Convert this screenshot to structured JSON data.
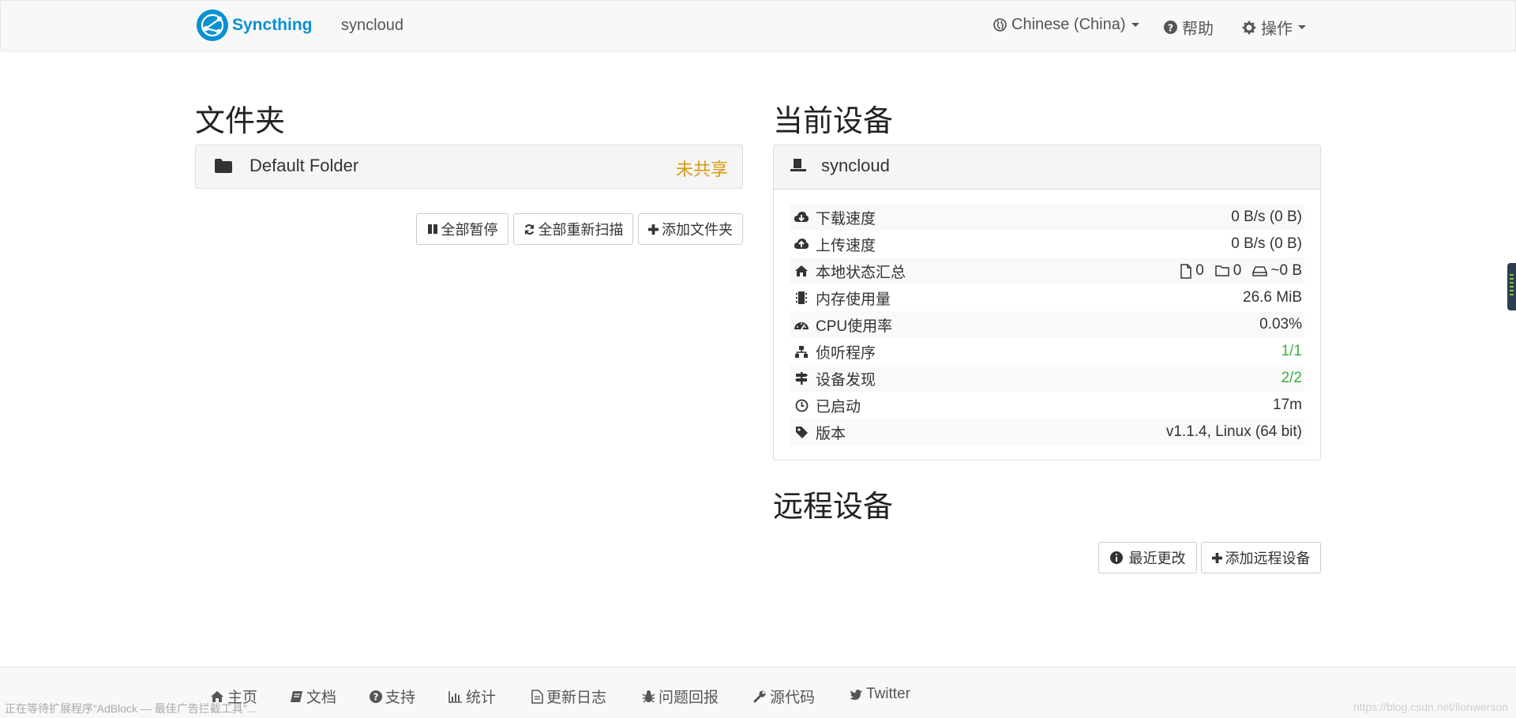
{
  "navbar": {
    "brand": "Syncthing",
    "device_name": "syncloud",
    "language": "Chinese (China)",
    "help": "帮助",
    "actions": "操作"
  },
  "folders": {
    "heading": "文件夹",
    "items": [
      {
        "name": "Default Folder",
        "status": "未共享"
      }
    ],
    "buttons": {
      "pause_all": "全部暂停",
      "rescan_all": "全部重新扫描",
      "add_folder": "添加文件夹"
    }
  },
  "this_device": {
    "heading": "当前设备",
    "name": "syncloud",
    "stats": [
      {
        "icon": "cloud-download-icon",
        "label": "下载速度",
        "value": "0 B/s (0 B)"
      },
      {
        "icon": "cloud-upload-icon",
        "label": "上传速度",
        "value": "0 B/s (0 B)"
      },
      {
        "icon": "home-icon",
        "label": "本地状态汇总",
        "value": ""
      },
      {
        "icon": "memory-icon",
        "label": "内存使用量",
        "value": "26.6 MiB"
      },
      {
        "icon": "dashboard-icon",
        "label": "CPU使用率",
        "value": "0.03%"
      },
      {
        "icon": "sitemap-icon",
        "label": "侦听程序",
        "value": "1/1"
      },
      {
        "icon": "signpost-icon",
        "label": "设备发现",
        "value": "2/2"
      },
      {
        "icon": "clock-icon",
        "label": "已启动",
        "value": "17m"
      },
      {
        "icon": "tag-icon",
        "label": "版本",
        "value": "v1.1.4, Linux (64 bit)"
      }
    ],
    "local_state": {
      "files": "0",
      "dirs": "0",
      "size": "~0 B"
    }
  },
  "remote_devices": {
    "heading": "远程设备",
    "buttons": {
      "recent_changes": "最近更改",
      "add_remote": "添加远程设备"
    }
  },
  "footer": {
    "links": [
      "主页",
      "文档",
      "支持",
      "统计",
      "更新日志",
      "问题回报",
      "源代码",
      "Twitter"
    ],
    "status": "正在等待扩展程序“AdBlock — 最佳广告拦截工具”...",
    "watermark": "https://blog.csdn.net/lionwerson"
  },
  "colors": {
    "brand": "#0891d1",
    "unshared": "#d89a10",
    "ok": "#3cb043"
  }
}
